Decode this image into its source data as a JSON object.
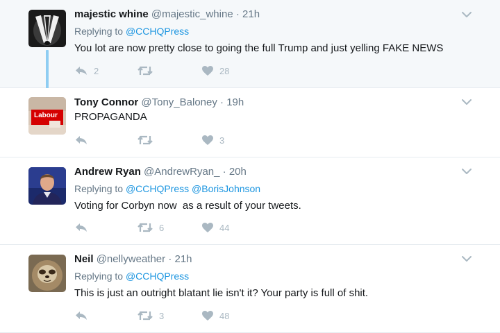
{
  "tweets": [
    {
      "name": "majestic whine",
      "handle": "@majestic_whine",
      "time": "· 21h",
      "replying_prefix": "Replying to",
      "mentions": [
        "@CCHQPress"
      ],
      "text": "You lot are now pretty close to going the full Trump and just yelling FAKE NEWS",
      "replies": "2",
      "retweets": "",
      "likes": "28",
      "avatar_icon": "badger-avatar"
    },
    {
      "name": "Tony Connor",
      "handle": "@Tony_Baloney",
      "time": "· 19h",
      "text": "PROPAGANDA",
      "replies": "",
      "retweets": "",
      "likes": "3",
      "avatar_icon": "labour-sign-avatar",
      "avatar_text": "Labour"
    },
    {
      "name": "Andrew Ryan",
      "handle": "@AndrewRyan_",
      "time": "· 20h",
      "replying_prefix": "Replying to",
      "mentions": [
        "@CCHQPress",
        "@BorisJohnson"
      ],
      "text": "Voting for Corbyn now  as a result of your tweets.",
      "replies": "",
      "retweets": "6",
      "likes": "44",
      "avatar_icon": "man-portrait-avatar"
    },
    {
      "name": "Neil",
      "handle": "@nellyweather",
      "time": "· 21h",
      "replying_prefix": "Replying to",
      "mentions": [
        "@CCHQPress"
      ],
      "text": "This is just an outright blatant lie isn't it? Your party is full of shit.",
      "replies": "",
      "retweets": "3",
      "likes": "48",
      "avatar_icon": "sloth-avatar"
    }
  ],
  "colors": {
    "link": "#1b95e0",
    "muted": "#657786",
    "icon": "#aab8c2",
    "highlight_bg": "#f5f8fa",
    "thread_line": "#8ecdf2"
  }
}
